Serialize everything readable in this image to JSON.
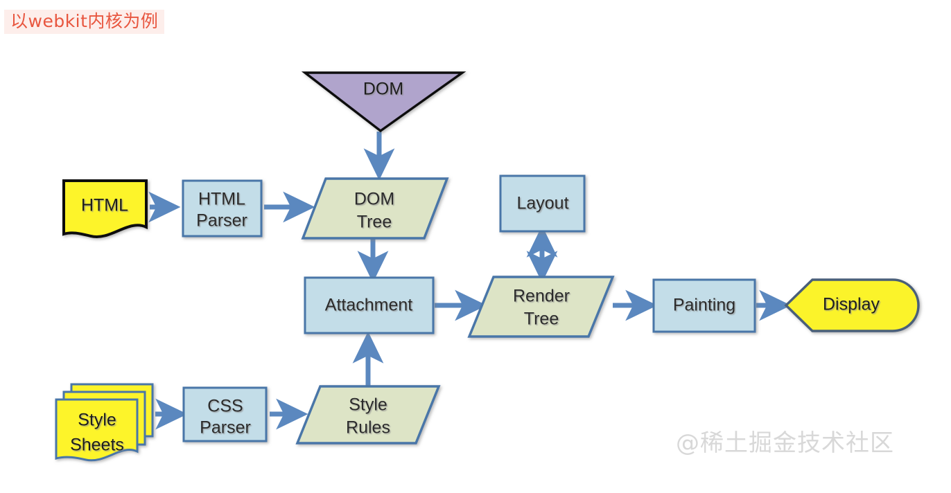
{
  "title_badge": {
    "text": "以webkit内核为例",
    "color": "#e8563f",
    "background": "#fdeeeb"
  },
  "watermark": {
    "text": "@稀土掘金技术社区",
    "color": "#d8d8d8"
  },
  "palette": {
    "process_fill": "#c3dde8",
    "process_stroke": "#4a76a8",
    "data_fill": "#dde4c6",
    "data_stroke": "#4a76a8",
    "document_fill": "#fdf42c",
    "document_stroke": "#111111",
    "sheet_stroke": "#4a76a8",
    "terminator_fill": "#fbf32b",
    "terminator_stroke": "#4a5f7a",
    "dom_fill": "#b0a4cc",
    "dom_stroke": "#111111",
    "arrow": "#5b88bf",
    "canvas": "#ffffff"
  },
  "nodes": {
    "dom": {
      "label": "DOM",
      "shape": "triangle-down"
    },
    "html_source": {
      "label": "HTML",
      "shape": "document"
    },
    "html_parser": {
      "label_line1": "HTML",
      "label_line2": "Parser",
      "shape": "process"
    },
    "dom_tree": {
      "label_line1": "DOM",
      "label_line2": "Tree",
      "shape": "data"
    },
    "layout": {
      "label": "Layout",
      "shape": "process"
    },
    "attachment": {
      "label": "Attachment",
      "shape": "process"
    },
    "render_tree": {
      "label_line1": "Render",
      "label_line2": "Tree",
      "shape": "data"
    },
    "painting": {
      "label": "Painting",
      "shape": "process"
    },
    "display": {
      "label": "Display",
      "shape": "terminator"
    },
    "style_sheets": {
      "label_line1": "Style",
      "label_line2": "Sheets",
      "shape": "multidocument"
    },
    "css_parser": {
      "label_line1": "CSS",
      "label_line2": "Parser",
      "shape": "process"
    },
    "style_rules": {
      "label_line1": "Style",
      "label_line2": "Rules",
      "shape": "data"
    }
  },
  "edges": [
    {
      "from": "html_source",
      "to": "html_parser",
      "direction": "right"
    },
    {
      "from": "html_parser",
      "to": "dom_tree",
      "direction": "right"
    },
    {
      "from": "dom",
      "to": "dom_tree",
      "direction": "down"
    },
    {
      "from": "dom_tree",
      "to": "attachment",
      "direction": "down"
    },
    {
      "from": "attachment",
      "to": "render_tree",
      "direction": "right"
    },
    {
      "from": "layout",
      "to": "render_tree",
      "direction": "bidirectional-vertical"
    },
    {
      "from": "render_tree",
      "to": "painting",
      "direction": "right"
    },
    {
      "from": "painting",
      "to": "display",
      "direction": "right"
    },
    {
      "from": "style_sheets",
      "to": "css_parser",
      "direction": "right"
    },
    {
      "from": "css_parser",
      "to": "style_rules",
      "direction": "right"
    },
    {
      "from": "style_rules",
      "to": "attachment",
      "direction": "up"
    }
  ]
}
